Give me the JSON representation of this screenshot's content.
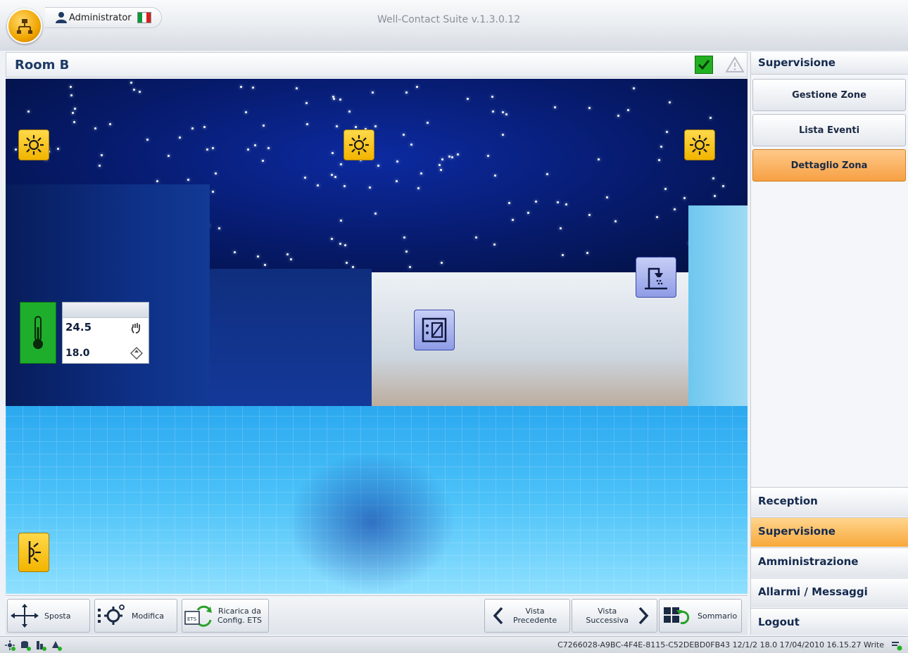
{
  "window": {
    "app_title": "Well-Contact Suite v.1.3.0.12",
    "user": "Administrator",
    "language_flag": "italy-flag"
  },
  "room": {
    "title": "Room B"
  },
  "thermostat": {
    "current_temp": "24.5",
    "setpoint": "18.0"
  },
  "toolbar": {
    "move": "Sposta",
    "edit": "Modifica",
    "reload_line1": "Ricarica da",
    "reload_line2": "Config. ETS",
    "prev_line1": "Vista",
    "prev_line2": "Precedente",
    "next_line1": "Vista",
    "next_line2": "Successiva",
    "summary": "Sommario"
  },
  "sidebar": {
    "title": "Supervisione",
    "buttons": [
      "Gestione Zone",
      "Lista Eventi",
      "Dettaglio Zona"
    ],
    "active_button": "Dettaglio Zona",
    "nav": [
      "Reception",
      "Supervisione",
      "Amministrazione",
      "Allarmi / Messaggi",
      "Logout"
    ],
    "active_nav": "Supervisione"
  },
  "statusbar": {
    "text": "C7266028-A9BC-4F4E-8115-C52DEBD0FB43 12/1/2 18.0 17/04/2010 16.15.27 Write"
  },
  "colors": {
    "accent_orange": "#f6a043",
    "status_green": "#21b021",
    "control_yellow": "#f2b400",
    "room_title_blue": "#1f3a66"
  }
}
